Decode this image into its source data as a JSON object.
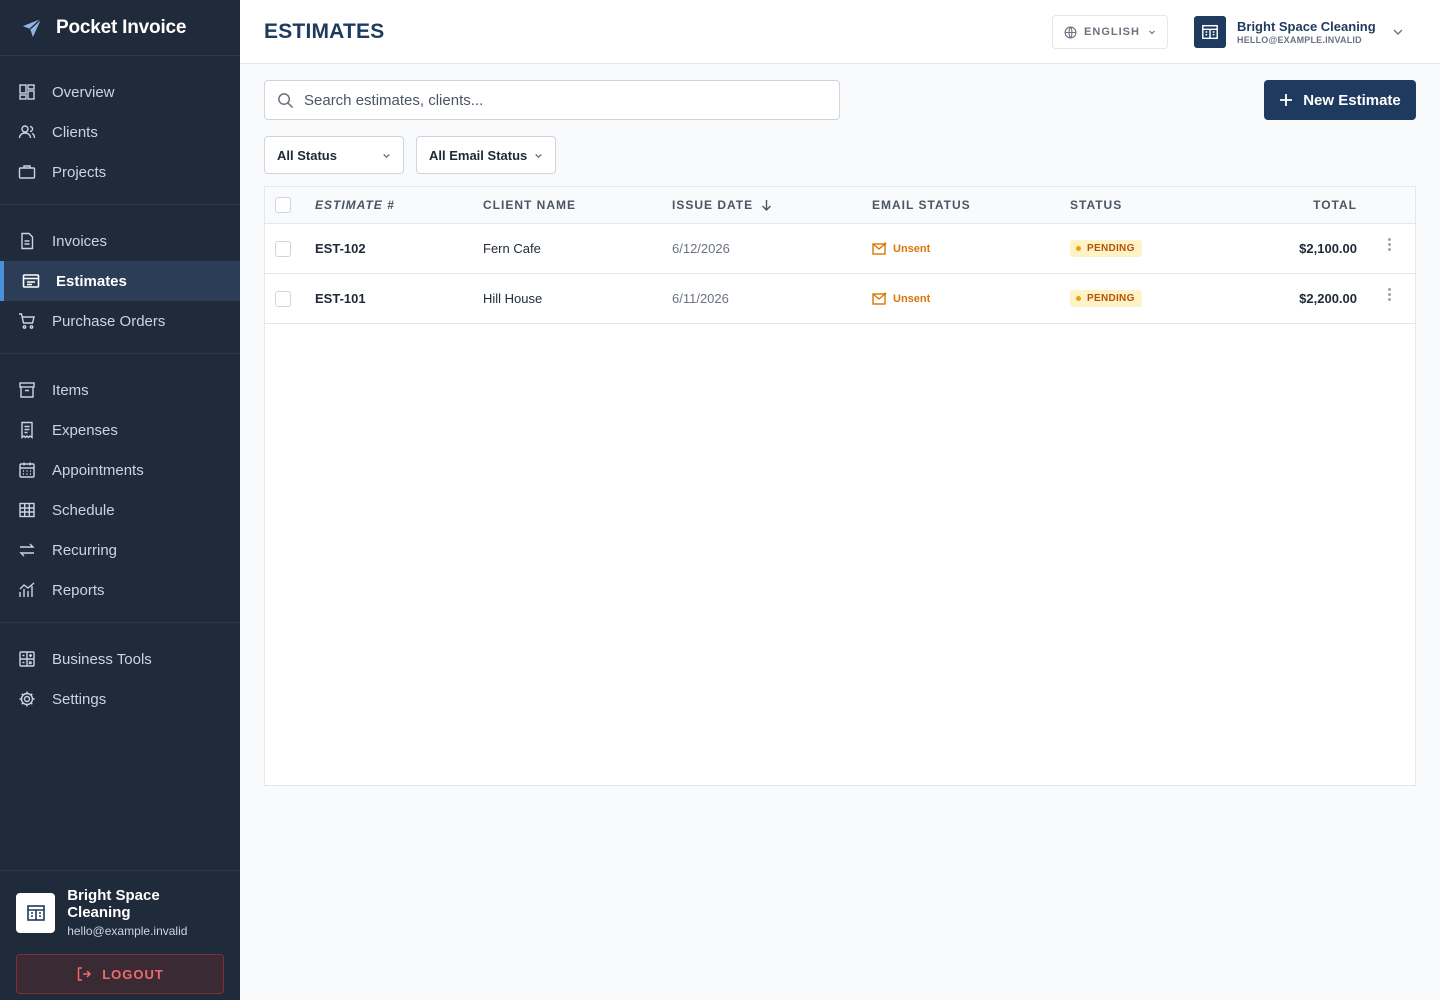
{
  "app": {
    "name": "Pocket Invoice"
  },
  "sidebar": {
    "groups": [
      [
        {
          "label": "Overview",
          "icon": "overview-icon"
        },
        {
          "label": "Clients",
          "icon": "clients-icon"
        },
        {
          "label": "Projects",
          "icon": "projects-icon"
        }
      ],
      [
        {
          "label": "Invoices",
          "icon": "invoice-icon"
        },
        {
          "label": "Estimates",
          "icon": "estimate-icon",
          "active": true
        },
        {
          "label": "Purchase Orders",
          "icon": "cart-icon"
        }
      ],
      [
        {
          "label": "Items",
          "icon": "items-icon"
        },
        {
          "label": "Expenses",
          "icon": "expenses-icon"
        },
        {
          "label": "Appointments",
          "icon": "calendar-icon"
        },
        {
          "label": "Schedule",
          "icon": "schedule-icon"
        },
        {
          "label": "Recurring",
          "icon": "recurring-icon"
        },
        {
          "label": "Reports",
          "icon": "reports-icon"
        }
      ],
      [
        {
          "label": "Business Tools",
          "icon": "tools-icon"
        },
        {
          "label": "Settings",
          "icon": "gear-icon"
        }
      ]
    ],
    "footer": {
      "company": "Bright Space Cleaning",
      "email": "hello@example.invalid",
      "logout_label": "LOGOUT"
    }
  },
  "header": {
    "title": "ESTIMATES",
    "language": "ENGLISH",
    "company": "Bright Space Cleaning",
    "email": "HELLO@EXAMPLE.INVALID"
  },
  "toolbar": {
    "search_placeholder": "Search estimates, clients...",
    "new_label": "New Estimate",
    "filters": {
      "status": "All Status",
      "email_status": "All Email Status"
    }
  },
  "table": {
    "columns": {
      "number": "ESTIMATE #",
      "client": "CLIENT NAME",
      "date": "ISSUE DATE",
      "email": "EMAIL STATUS",
      "status": "STATUS",
      "total": "TOTAL"
    },
    "rows": [
      {
        "number": "EST-102",
        "client": "Fern Cafe",
        "date": "6/12/2026",
        "email_status": "Unsent",
        "status": "PENDING",
        "total": "$2,100.00"
      },
      {
        "number": "EST-101",
        "client": "Hill House",
        "date": "6/11/2026",
        "email_status": "Unsent",
        "status": "PENDING",
        "total": "$2,200.00"
      }
    ]
  },
  "colors": {
    "sidebar_bg": "#1f2a3a",
    "primary": "#1e3a5f",
    "pending_text": "#b45309",
    "pending_bg": "#fef3c7",
    "unsent": "#d97706",
    "logout": "#ef6b6b"
  }
}
